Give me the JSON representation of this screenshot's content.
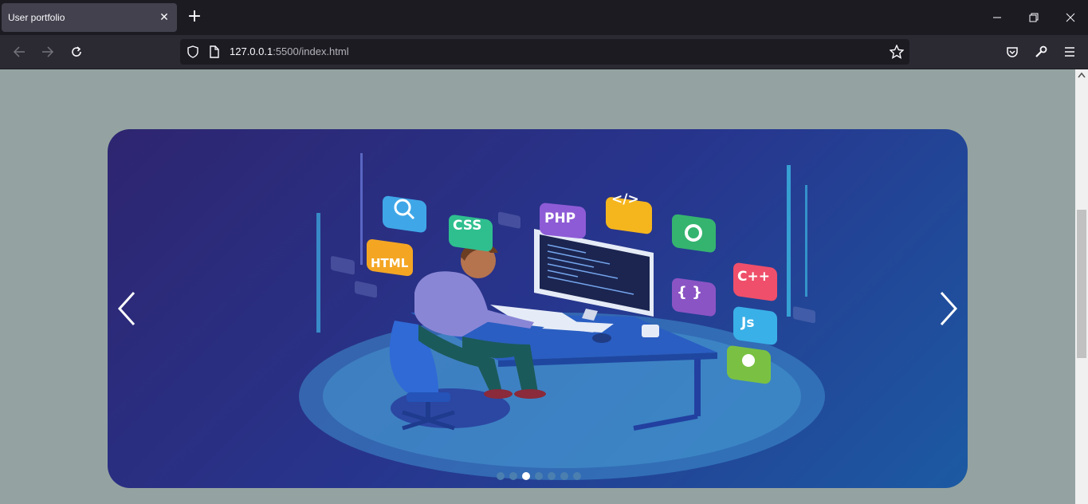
{
  "browser": {
    "tab_title": "User portfolio",
    "url_host": "127.0.0.1",
    "url_path": ":5500/index.html"
  },
  "carousel": {
    "slide_count": 7,
    "active_slide": 3,
    "icons": {
      "css": "CSS",
      "php": "PHP",
      "code": "</>",
      "html": "HTML",
      "cpp": "C++",
      "braces": "{ }",
      "js": "Js"
    }
  },
  "colors": {
    "page_bg": "#94a3a1",
    "carousel_start": "#2e2570",
    "carousel_end": "#1c5aa3"
  }
}
